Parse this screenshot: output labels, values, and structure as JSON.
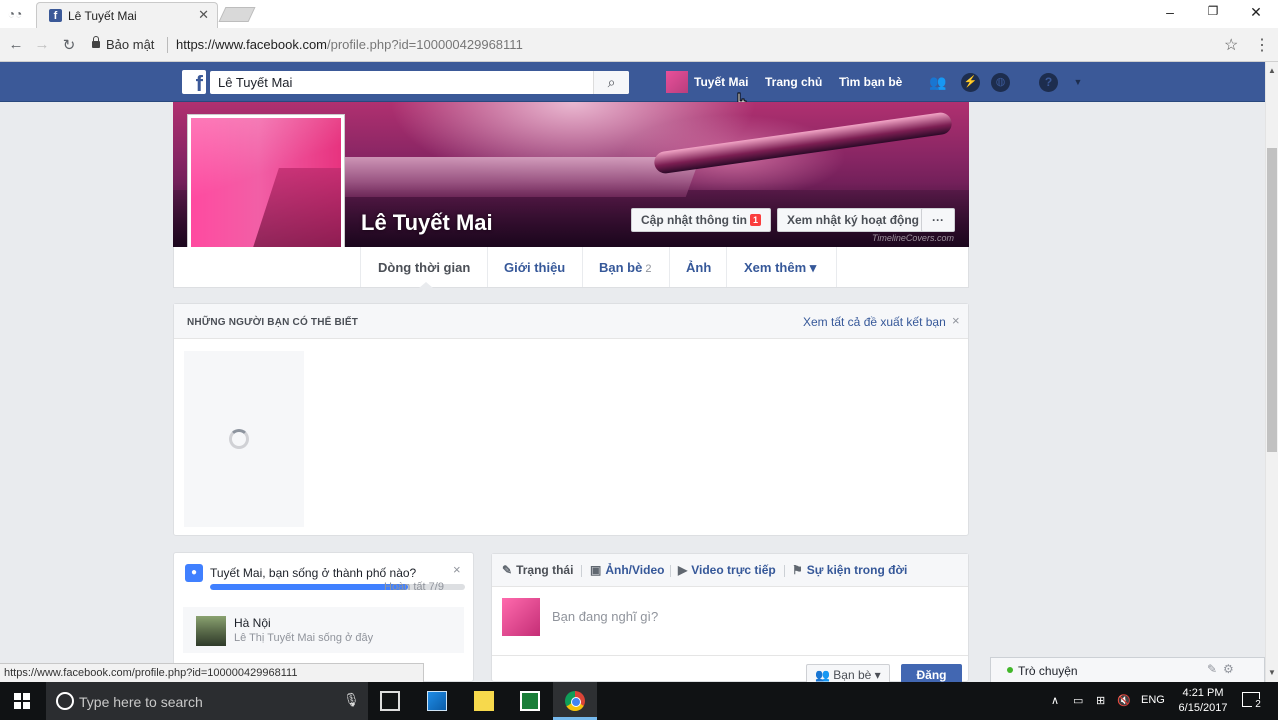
{
  "browser": {
    "tab_title": "Lê Tuyết Mai",
    "secure_label": "Bảo mật",
    "url_host": "https://www.facebook.com",
    "url_path": "/profile.php?id=100000429968111",
    "status_url": "https://www.facebook.com/profile.php?id=100000429968111"
  },
  "fb_header": {
    "logo": "f",
    "search_value": "Lê Tuyết Mai",
    "user_name": "Tuyết Mai",
    "home_label": "Trang chủ",
    "find_friends_label": "Tìm bạn bè"
  },
  "profile": {
    "name": "Lê Tuyết Mai",
    "update_info_label": "Cập nhật thông tin",
    "update_info_badge": "1",
    "activity_log_label": "Xem nhật ký hoạt động",
    "more_label": "···",
    "watermark": "TimelineCovers.com"
  },
  "timeline_nav": {
    "items": [
      {
        "label": "Dòng thời gian"
      },
      {
        "label": "Giới thiệu"
      },
      {
        "label": "Bạn bè",
        "count": "2"
      },
      {
        "label": "Ảnh"
      },
      {
        "label": "Xem thêm ▾"
      }
    ]
  },
  "pymk": {
    "title": "NHỮNG NGƯỜI BẠN CÓ THỂ BIẾT",
    "see_all": "Xem tất cả đề xuất kết bạn",
    "close": "×"
  },
  "profile_prompt": {
    "question": "Tuyết Mai, bạn sống ở thành phố nào?",
    "close": "×",
    "progress_fraction": 0.778,
    "progress_text": "Hoàn tất 7/9",
    "city_name": "Hà Nội",
    "city_sub": "Lê Thị Tuyết Mai sống ở đây"
  },
  "composer": {
    "tabs": [
      {
        "icon": "✎",
        "label": "Trạng thái"
      },
      {
        "icon": "▣",
        "label": "Ảnh/Video"
      },
      {
        "icon": "▶",
        "label": "Video trực tiếp"
      },
      {
        "icon": "⚑",
        "label": "Sự kiện trong đời"
      }
    ],
    "placeholder": "Bạn đang nghĩ gì?",
    "audience": "Bạn bè ▾",
    "post_label": "Đăng"
  },
  "chat": {
    "label": "Trò chuyện"
  },
  "taskbar": {
    "search_placeholder": "Type here to search",
    "lang": "ENG",
    "time": "4:21 PM",
    "date": "6/15/2017",
    "notifications": "2"
  },
  "colors": {
    "fb_blue": "#3b5998",
    "link": "#365899",
    "post_button": "#4267b2",
    "progress": "#4080ff",
    "online": "#42b72a"
  }
}
